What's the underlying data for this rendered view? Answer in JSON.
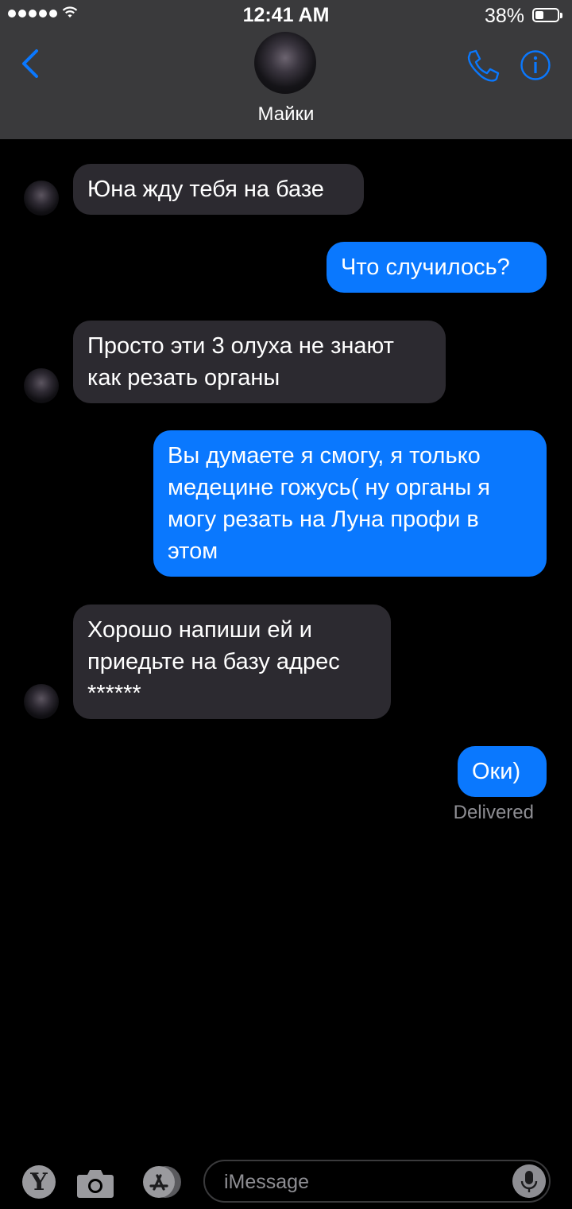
{
  "status_bar": {
    "time": "12:41 AM",
    "battery_percent_text": "38%",
    "battery_level": 0.38,
    "signal_bars": 5,
    "icons": [
      "signal-dots-icon",
      "wifi-icon",
      "battery-icon"
    ]
  },
  "header": {
    "contact_name": "Майки",
    "icons": [
      "chevron-left-icon",
      "phone-icon",
      "info-icon"
    ],
    "accent_color": "#0a78fe"
  },
  "messages": [
    {
      "direction": "incoming",
      "text": "Юна жду тебя на базе"
    },
    {
      "direction": "outgoing",
      "text": "Что случилось?"
    },
    {
      "direction": "incoming",
      "text": "Просто эти 3 олуха не знают как резать органы"
    },
    {
      "direction": "outgoing",
      "text": "Вы думаете я смогу, я только медецине гожусь( ну органы я могу резать на Луна профи в этом"
    },
    {
      "direction": "incoming",
      "text": "Хорошо напиши ей и приедьте на базу адрес ******"
    },
    {
      "direction": "outgoing",
      "text": "Оки)"
    }
  ],
  "delivered_label": "Delivered",
  "composer": {
    "placeholder": "iMessage",
    "app_y_label": "Y",
    "icons": [
      "camera-icon",
      "app-store-icon",
      "microphone-icon"
    ]
  },
  "colors": {
    "incoming_bubble": "#2c2a30",
    "outgoing_bubble": "#0a78fe",
    "header_background": "#3a3a3c",
    "background": "#000000"
  }
}
